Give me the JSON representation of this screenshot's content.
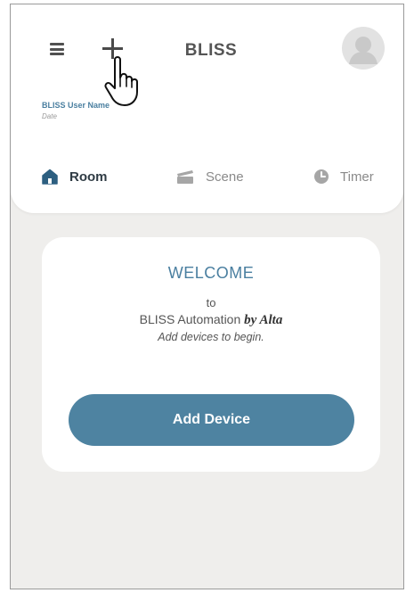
{
  "header": {
    "app_title": "BLISS",
    "menu_icon": "menu-icon",
    "add_icon": "plus-icon",
    "avatar_icon": "user-avatar-icon"
  },
  "user": {
    "name": "BLISS User Name",
    "date": "Date"
  },
  "tabs": [
    {
      "label": "Room",
      "icon": "home-icon",
      "active": true
    },
    {
      "label": "Scene",
      "icon": "scene-icon",
      "active": false
    },
    {
      "label": "Timer",
      "icon": "clock-icon",
      "active": false
    }
  ],
  "welcome": {
    "title": "WELCOME",
    "to": "to",
    "app_name": "BLISS Automation",
    "by": "by Alta",
    "subtitle": "Add devices to begin.",
    "button_label": "Add Device"
  },
  "colors": {
    "accent": "#4e83a1",
    "background": "#efeeec",
    "card": "#ffffff"
  }
}
